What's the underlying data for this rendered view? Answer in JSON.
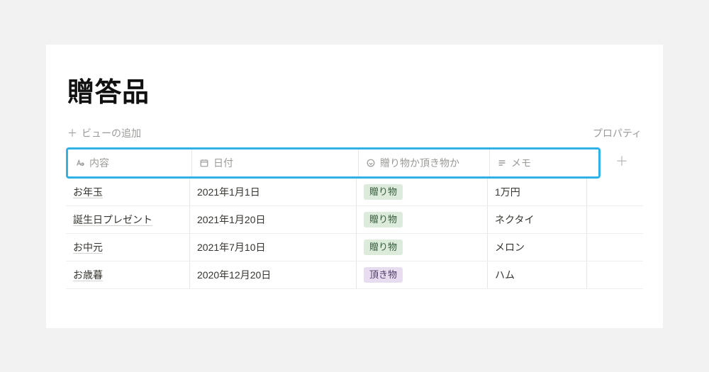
{
  "title": "贈答品",
  "toolbar": {
    "add_view": "ビューの追加",
    "properties": "プロパティ"
  },
  "columns": {
    "name": "内容",
    "date": "日付",
    "type": "贈り物か頂き物か",
    "memo": "メモ"
  },
  "rows": [
    {
      "name": "お年玉",
      "date": "2021年1月1日",
      "type": "贈り物",
      "type_color": "green",
      "memo": "1万円"
    },
    {
      "name": "誕生日プレゼント",
      "date": "2021年1月20日",
      "type": "贈り物",
      "type_color": "green",
      "memo": "ネクタイ"
    },
    {
      "name": "お中元",
      "date": "2021年7月10日",
      "type": "贈り物",
      "type_color": "green",
      "memo": "メロン"
    },
    {
      "name": "お歳暮",
      "date": "2020年12月20日",
      "type": "頂き物",
      "type_color": "purple",
      "memo": "ハム"
    }
  ]
}
